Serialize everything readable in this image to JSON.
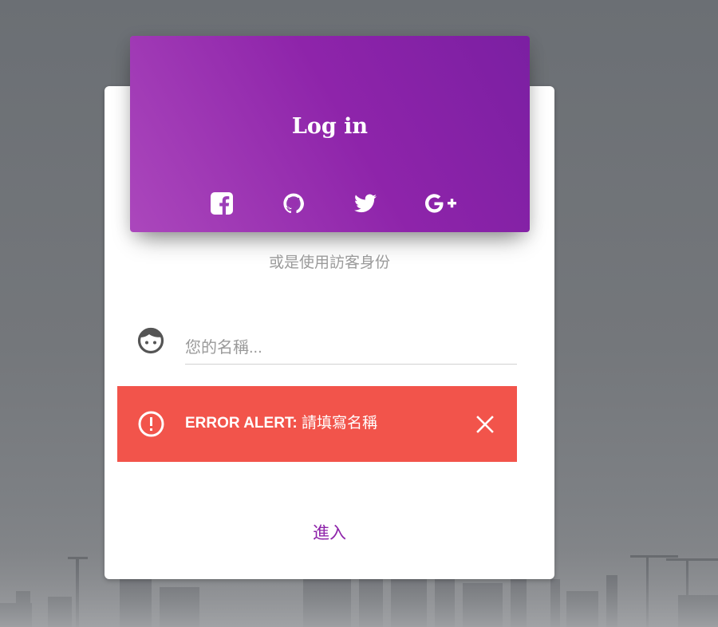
{
  "colors": {
    "accent": "#8e24aa",
    "header_gradient_start": "#ab47bc",
    "header_gradient_end": "#7b1fa2",
    "alert_background": "#f2544b",
    "muted_text": "#9a9a9a"
  },
  "login_card": {
    "title": "Log in",
    "social_buttons": [
      {
        "icon": "facebook-square-icon"
      },
      {
        "icon": "github-icon"
      },
      {
        "icon": "twitter-icon"
      },
      {
        "icon": "google-plus-icon"
      }
    ],
    "guest_text": "或是使用訪客身份",
    "name_field": {
      "icon": "face-icon",
      "placeholder": "您的名稱...",
      "value": ""
    },
    "alert": {
      "icon": "error-outline-icon",
      "label": "ERROR ALERT:",
      "message": " 請填寫名稱",
      "close_icon": "close-icon"
    },
    "submit_label": "進入"
  }
}
